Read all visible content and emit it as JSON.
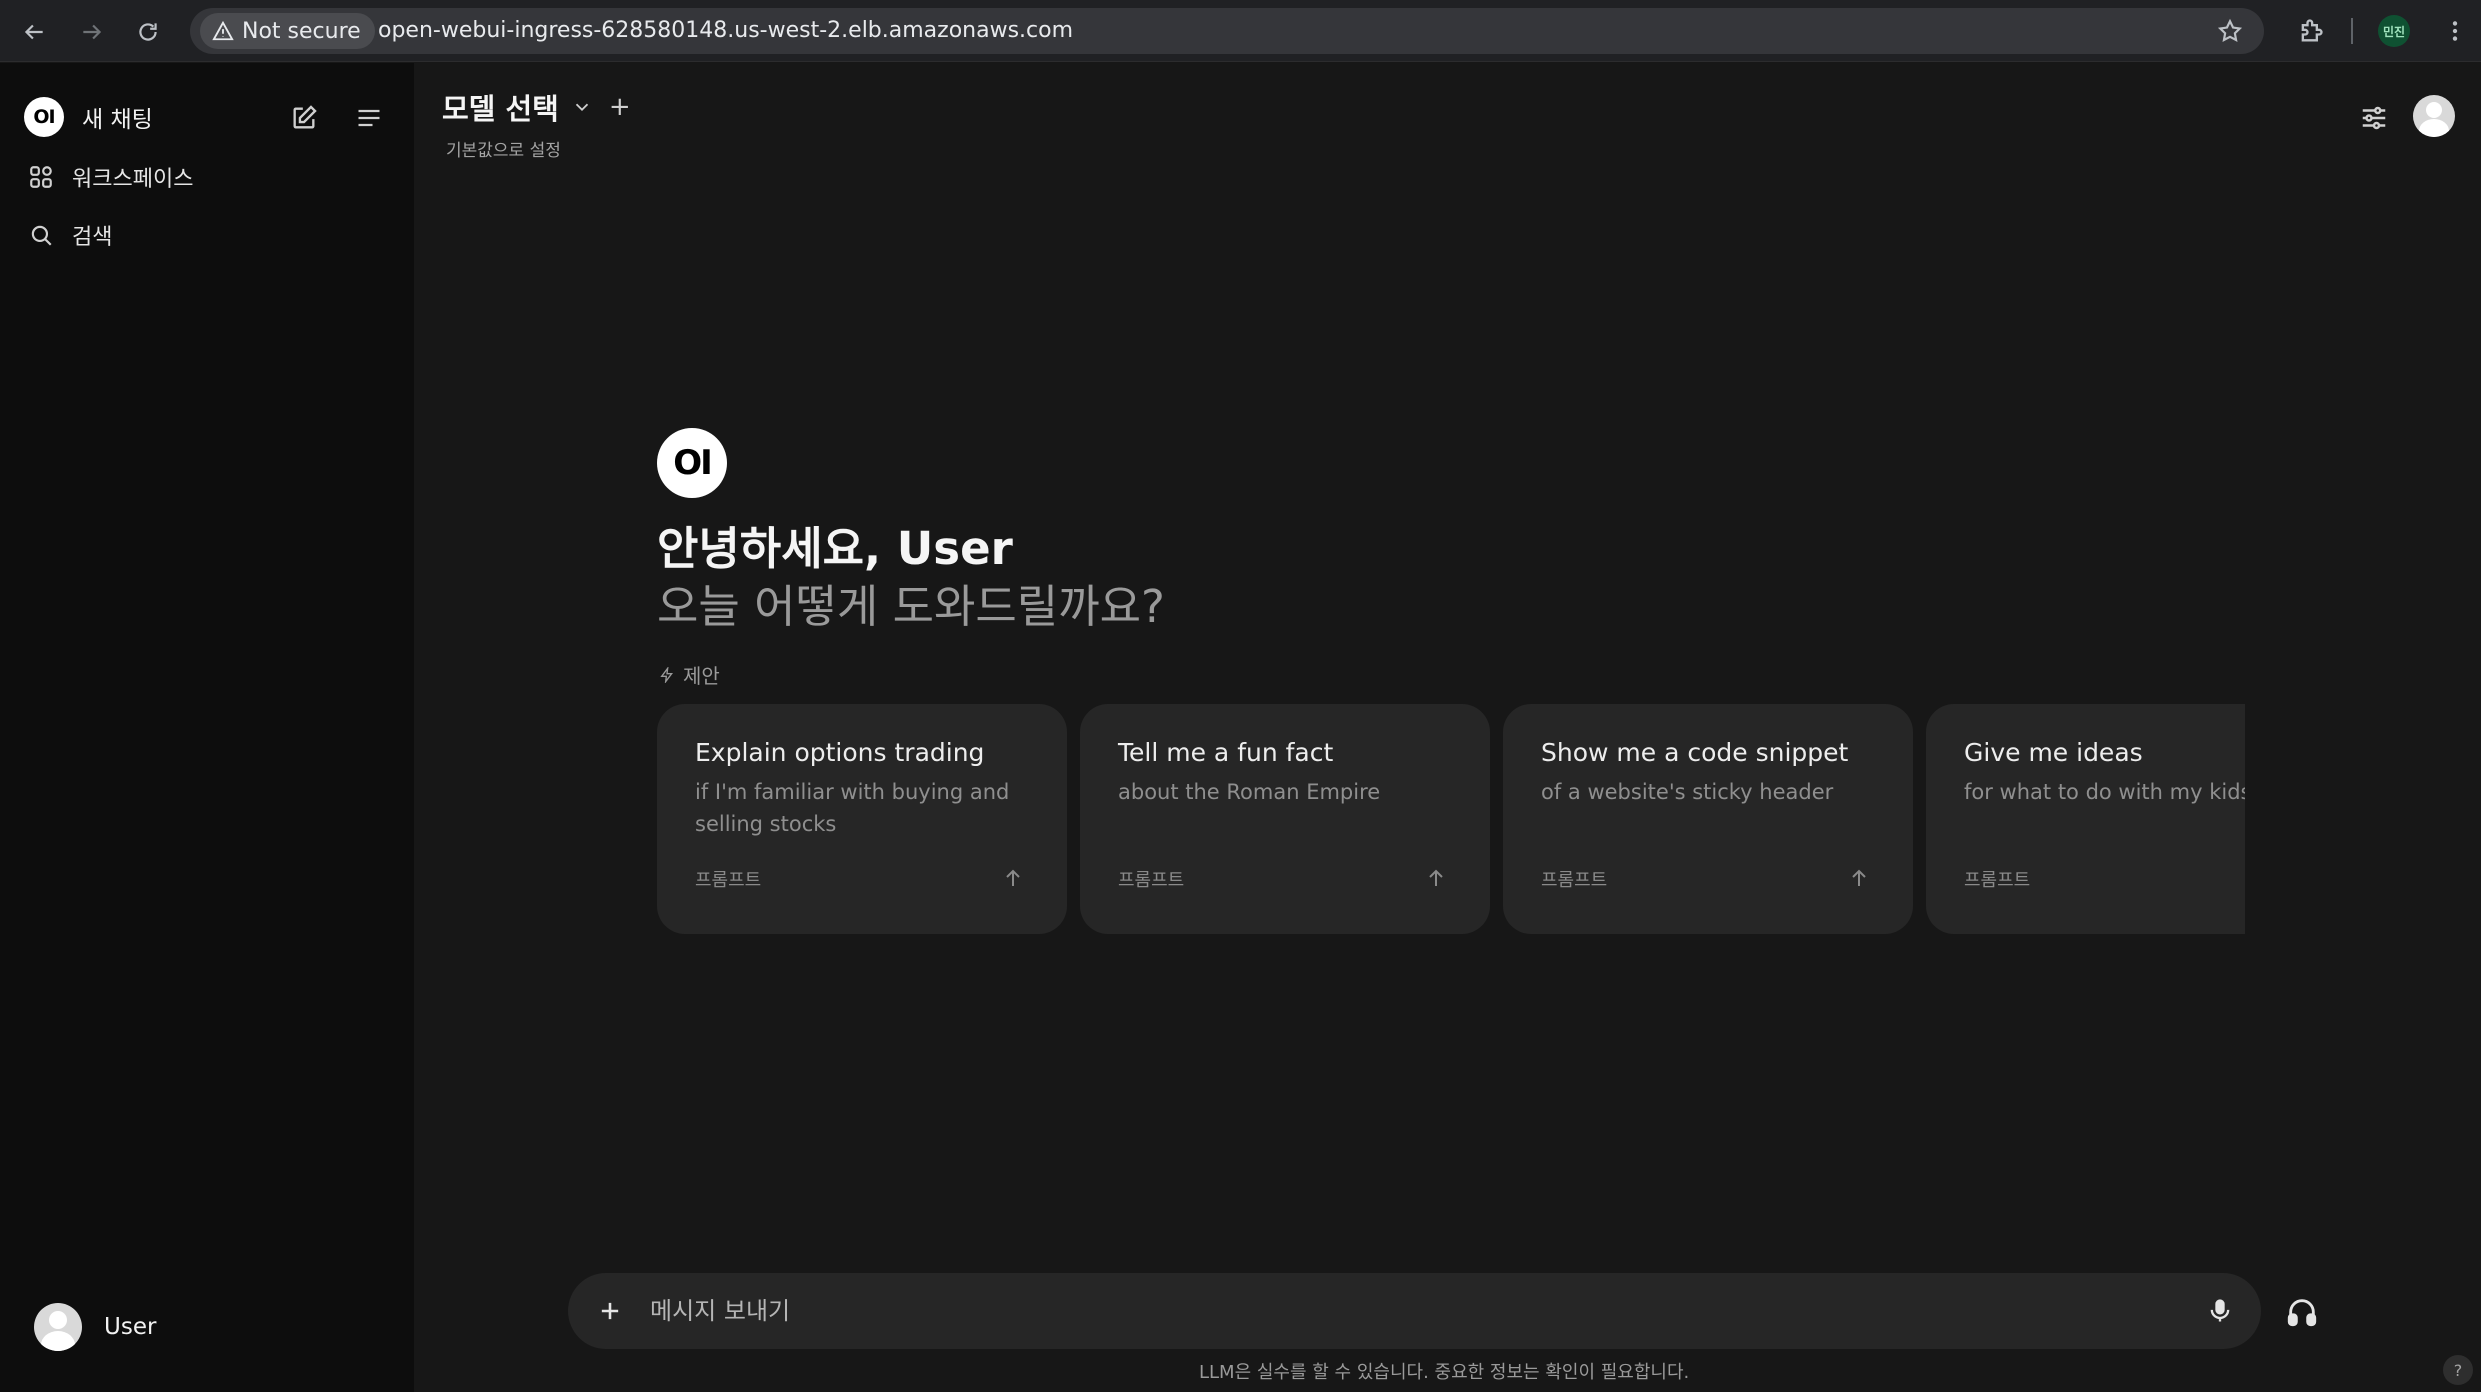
{
  "browser": {
    "security_label": "Not secure",
    "url": "open-webui-ingress-628580148.us-west-2.elb.amazonaws.com",
    "profile_initials": "민진"
  },
  "sidebar": {
    "logo_text": "OI",
    "new_chat_label": "새 채팅",
    "items": [
      {
        "label": "워크스페이스",
        "icon": "workspace-grid-icon"
      },
      {
        "label": "검색",
        "icon": "search-icon"
      }
    ],
    "user_name": "User"
  },
  "header": {
    "model_select_label": "모델 선택",
    "set_default_label": "기본값으로 설정"
  },
  "hero": {
    "logo_text": "OI",
    "greeting": "안녕하세요, User",
    "subgreeting": "오늘 어떻게 도와드릴까요?",
    "suggestions_label": "제안"
  },
  "suggestions": [
    {
      "title": "Explain options trading",
      "subtitle": "if I'm familiar with buying and selling stocks",
      "tag": "프롬프트"
    },
    {
      "title": "Tell me a fun fact",
      "subtitle": "about the Roman Empire",
      "tag": "프롬프트"
    },
    {
      "title": "Show me a code snippet",
      "subtitle": "of a website's sticky header",
      "tag": "프롬프트"
    },
    {
      "title": "Give me ideas",
      "subtitle": "for what to do with my kids' art",
      "tag": "프롬프트"
    }
  ],
  "composer": {
    "placeholder": "메시지 보내기",
    "disclaimer": "LLM은 실수를 할 수 있습니다. 중요한 정보는 확인이 필요합니다.",
    "help_label": "?"
  },
  "colors": {
    "background": "#171717",
    "sidebar": "#0d0d0d",
    "card": "#262626",
    "text_primary": "#ececec",
    "text_muted": "#9a9a9a"
  }
}
